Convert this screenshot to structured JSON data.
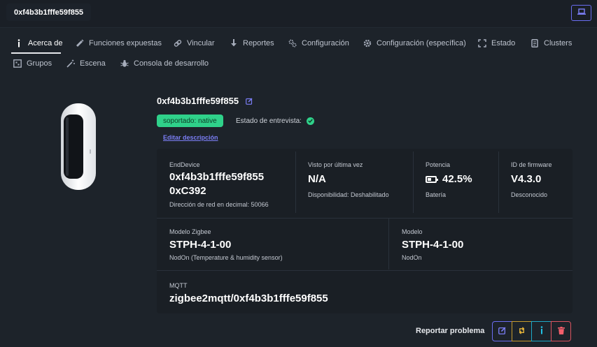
{
  "header": {
    "device_name": "0xf4b3b1fffe59f855"
  },
  "tabs": [
    {
      "label": "Acerca de",
      "icon": "info-icon",
      "active": true
    },
    {
      "label": "Funciones expuestas",
      "icon": "wand-icon"
    },
    {
      "label": "Vincular",
      "icon": "link-icon"
    },
    {
      "label": "Reportes",
      "icon": "download-icon"
    },
    {
      "label": "Configuración",
      "icon": "cogs-icon"
    },
    {
      "label": "Configuración (específica)",
      "icon": "gear-icon"
    },
    {
      "label": "Estado",
      "icon": "expand-icon"
    },
    {
      "label": "Clusters",
      "icon": "document-icon"
    },
    {
      "label": "Grupos",
      "icon": "grid-icon"
    },
    {
      "label": "Escena",
      "icon": "magic-icon"
    },
    {
      "label": "Consola de desarrollo",
      "icon": "bug-icon"
    }
  ],
  "device": {
    "title": "0xf4b3b1fffe59f855",
    "support_badge": "soportado: native",
    "interview_label": "Estado de entrevista:",
    "edit_description": "Editar descripción"
  },
  "info": {
    "type_label": "EndDevice",
    "ieee": "0xf4b3b1fffe59f855",
    "network_address": "0xC392",
    "network_decimal": "Dirección de red en decimal: 50066",
    "last_seen_label": "Visto por última vez",
    "last_seen_value": "N/A",
    "availability": "Disponibilidad: Deshabilitado",
    "power_label": "Potencia",
    "power_value": "42.5%",
    "power_source": "Batería",
    "battery_level": 0.425,
    "firmware_label": "ID de firmware",
    "firmware_value": "V4.3.0",
    "firmware_date": "Desconocido",
    "zigbee_model_label": "Modelo Zigbee",
    "zigbee_model_value": "STPH-4-1-00",
    "zigbee_model_desc": "NodOn (Temperature & humidity sensor)",
    "model_label": "Modelo",
    "model_value": "STPH-4-1-00",
    "model_vendor": "NodOn",
    "mqtt_label": "MQTT",
    "mqtt_value": "zigbee2mqtt/0xf4b3b1fffe59f855"
  },
  "footer": {
    "report_problem": "Reportar problema"
  },
  "colors": {
    "accent": "#7b7ef5",
    "success": "#2fd18a",
    "warning": "#e5b33a",
    "info": "#22c3e6",
    "danger": "#f25f6b",
    "background": "#1d232a"
  }
}
